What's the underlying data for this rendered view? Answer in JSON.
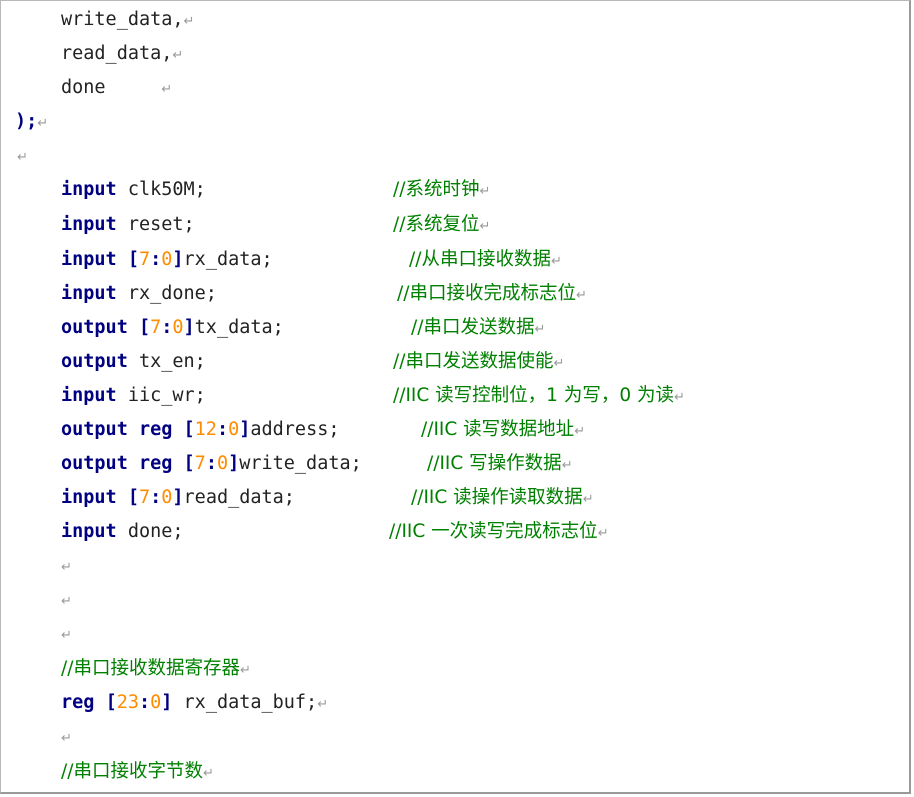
{
  "code": {
    "write_data_port": "write_data,",
    "read_data_port": "read_data,",
    "done_port": "done",
    "close_paren": ");",
    "kw_input": "input",
    "kw_output": "output",
    "kw_reg": "reg",
    "clk_decl": " clk50M;",
    "clk_comment": "//系统时钟",
    "reset_decl": " reset;",
    "reset_comment": "//系统复位",
    "rx_data_hi": "7",
    "rx_data_lo": "0",
    "rx_data_name": "rx_data;",
    "rx_data_comment": "//从串口接收数据",
    "rx_done_decl": " rx_done;",
    "rx_done_comment": "//串口接收完成标志位",
    "tx_data_hi": "7",
    "tx_data_lo": "0",
    "tx_data_name": "tx_data;",
    "tx_data_comment": "//串口发送数据",
    "tx_en_decl": " tx_en;",
    "tx_en_comment": "//串口发送数据使能",
    "iic_wr_decl": " iic_wr;",
    "iic_wr_comment": "//IIC 读写控制位，1 为写，0 为读",
    "address_hi": "12",
    "address_lo": "0",
    "address_name": "address;",
    "address_comment": "//IIC 读写数据地址",
    "write_data_hi": "7",
    "write_data_lo": "0",
    "write_data_name": "write_data;",
    "write_data_comment": "//IIC 写操作数据",
    "read_data_hi": "7",
    "read_data_lo": "0",
    "read_data_name": "read_data;",
    "read_data_comment": "//IIC 读操作读取数据",
    "done_decl": " done;",
    "done_comment": "//IIC 一次读写完成标志位",
    "rx_buf_comment": "//串口接收数据寄存器",
    "rx_buf_hi": "23",
    "rx_buf_lo": "0",
    "rx_buf_name": " rx_data_buf;",
    "byte_count_comment": "//串口接收字节数"
  },
  "paragraph_mark": "↵"
}
